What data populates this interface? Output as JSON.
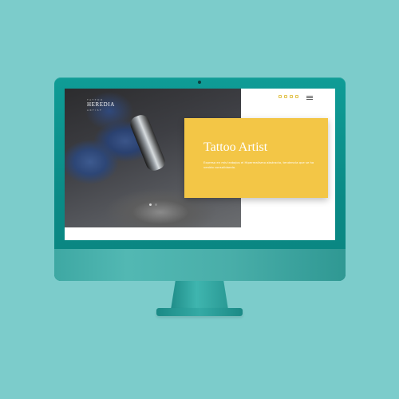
{
  "site": {
    "logo": {
      "top": "TATTOO",
      "name": "HEREDIA",
      "bottom": "ARTIST"
    },
    "social_icons": [
      "whatsapp-icon",
      "facebook-icon",
      "instagram-icon",
      "youtube-icon"
    ],
    "menu_icon": "hamburger-menu-icon",
    "hero": {
      "title": "Tattoo Artist",
      "description": "Expreso en mis trabajos el Hiperrealismo abstracto, tendencia que se ha venido consolidando."
    },
    "slider": {
      "count": 2,
      "active": 1
    }
  },
  "colors": {
    "background": "#7ccccb",
    "monitor": "#0f9c96",
    "card": "#f3c646",
    "icons": "#e2c24a"
  }
}
